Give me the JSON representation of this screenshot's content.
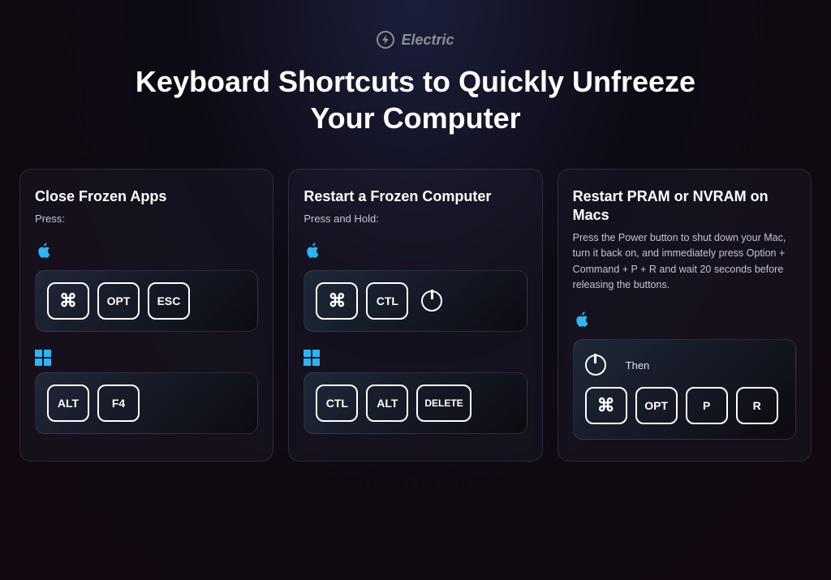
{
  "brand": {
    "name": "Electric"
  },
  "title": "Keyboard Shortcuts to Quickly Unfreeze Your Computer",
  "cards": [
    {
      "title": "Close Frozen Apps",
      "instruction": "Press:",
      "mac": {
        "keys": [
          "⌘",
          "OPT",
          "ESC"
        ]
      },
      "win": {
        "keys": [
          "ALT",
          "F4"
        ]
      }
    },
    {
      "title": "Restart a Frozen Computer",
      "instruction": "Press and Hold:",
      "mac": {
        "keys": [
          "⌘",
          "CTL"
        ],
        "power": true
      },
      "win": {
        "keys": [
          "CTL",
          "ALT",
          "DELETE"
        ]
      }
    },
    {
      "title": "Restart PRAM or NVRAM on Macs",
      "description": "Press the Power button to shut down your Mac, turn it back on, and immediately press Option + Command + P + R and wait 20 seconds before releasing the buttons.",
      "mac_combo": {
        "power": true,
        "then": "Then",
        "keys": [
          "⌘",
          "OPT",
          "P",
          "R"
        ]
      }
    }
  ]
}
